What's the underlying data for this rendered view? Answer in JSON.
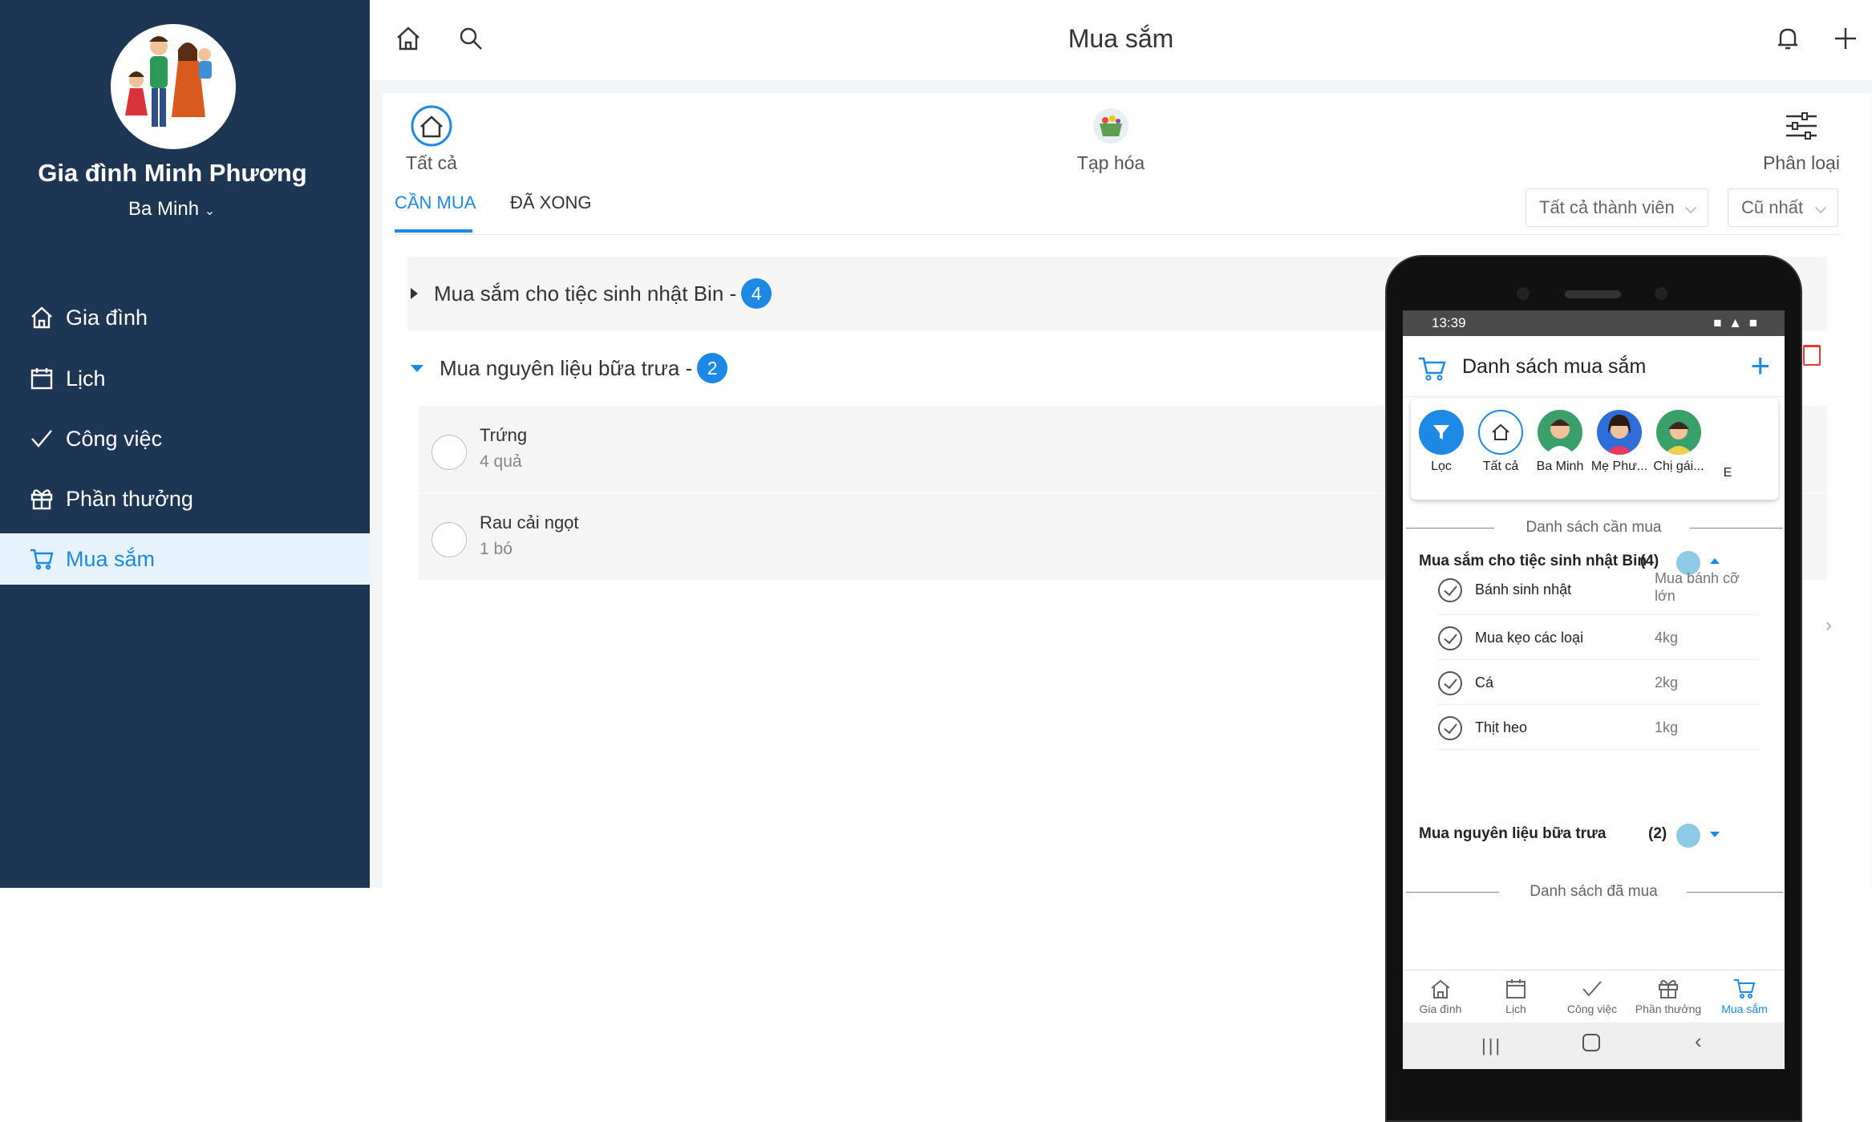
{
  "sidebar": {
    "family_name": "Gia đình Minh Phương",
    "current_user": "Ba Minh",
    "items": [
      {
        "label": "Gia đình",
        "icon": "home-icon"
      },
      {
        "label": "Lịch",
        "icon": "calendar-icon"
      },
      {
        "label": "Công việc",
        "icon": "check-icon"
      },
      {
        "label": "Phần thưởng",
        "icon": "gift-icon"
      },
      {
        "label": "Mua sắm",
        "icon": "cart-icon",
        "active": true
      }
    ]
  },
  "header": {
    "title": "Mua sắm"
  },
  "categories": [
    {
      "label": "Tất cả",
      "icon": "house-circle-icon"
    },
    {
      "label": "Tạp hóa",
      "icon": "grocery-basket-icon"
    },
    {
      "label": "Phân loại",
      "icon": "sliders-icon"
    }
  ],
  "tabs": [
    {
      "label": "CẦN MUA",
      "active": true
    },
    {
      "label": "ĐÃ XONG",
      "active": false
    }
  ],
  "filters": {
    "member": "Tất cả thành viên",
    "sort": "Cũ nhất"
  },
  "groups": [
    {
      "title": "Mua sắm cho tiệc sinh nhật Bin -",
      "count": "4",
      "expanded": false
    },
    {
      "title": "Mua nguyên liệu bữa trưa -",
      "count": "2",
      "expanded": true,
      "items": [
        {
          "name": "Trứng",
          "qty": "4 quả"
        },
        {
          "name": "Rau cải ngọt",
          "qty": "1 bó"
        }
      ]
    }
  ],
  "phone": {
    "status_time": "13:39",
    "header_title": "Danh sách mua sắm",
    "filter_chips": [
      {
        "label": "Lọc"
      },
      {
        "label": "Tất cả"
      },
      {
        "label": "Ba Minh"
      },
      {
        "label": "Mẹ Phư..."
      },
      {
        "label": "Chị gái..."
      },
      {
        "label": "E"
      }
    ],
    "section_to_buy": "Danh sách cần mua",
    "section_done": "Danh sách đã mua",
    "groups": [
      {
        "title": "Mua sắm cho tiệc sinh nhật Bin",
        "count": "(4)",
        "items": [
          {
            "name": "Bánh sinh nhật",
            "qty": "Mua bánh cỡ lớn"
          },
          {
            "name": "Mua kẹo các loại",
            "qty": "4kg"
          },
          {
            "name": "Cá",
            "qty": "2kg"
          },
          {
            "name": "Thịt heo",
            "qty": "1kg"
          }
        ]
      },
      {
        "title": "Mua nguyên liệu bữa trưa",
        "count": "(2)"
      }
    ],
    "bottom_nav": [
      {
        "label": "Gia đình"
      },
      {
        "label": "Lịch"
      },
      {
        "label": "Công việc"
      },
      {
        "label": "Phần thưởng"
      },
      {
        "label": "Mua sắm",
        "active": true
      }
    ]
  },
  "colors": {
    "sidebar_bg": "#1c3653",
    "accent": "#1e88e5"
  }
}
